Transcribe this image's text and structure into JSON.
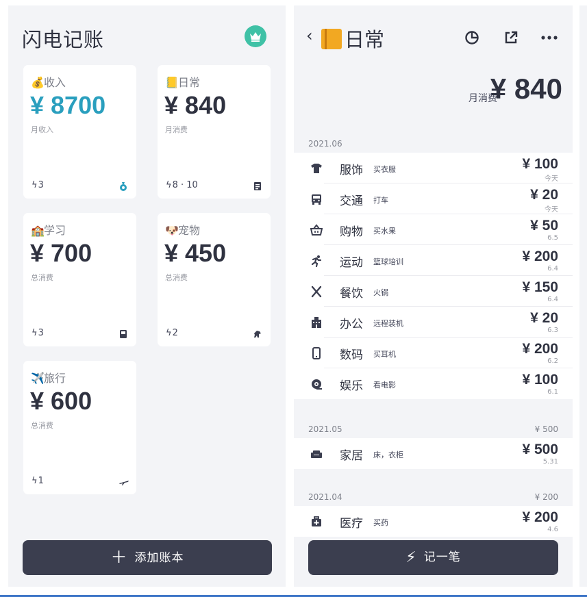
{
  "left": {
    "title": "闪电记账",
    "premium_icon": "crown-icon",
    "books": [
      {
        "emoji": "💰",
        "name": "收入",
        "amount": "¥ 8700",
        "subtitle": "月收入",
        "count": "3",
        "icon": "money-bag-icon",
        "accent": "#2a9fbe"
      },
      {
        "emoji": "📒",
        "name": "日常",
        "amount": "¥ 840",
        "subtitle": "月消费",
        "count": "8 · 10",
        "icon": "notes-icon"
      },
      {
        "emoji": "🏫",
        "name": "学习",
        "amount": "¥ 700",
        "subtitle": "总消费",
        "count": "3",
        "icon": "book-icon"
      },
      {
        "emoji": "🐶",
        "name": "宠物",
        "amount": "¥ 450",
        "subtitle": "总消费",
        "count": "2",
        "icon": "dog-icon"
      },
      {
        "emoji": "✈️",
        "name": "旅行",
        "amount": "¥ 600",
        "subtitle": "总消费",
        "count": "1",
        "icon": "plane-icon"
      }
    ],
    "add_button": {
      "icon": "＋",
      "label": "添加账本"
    }
  },
  "right": {
    "back_icon": "‹",
    "book_emoji": "📒",
    "title": "日常",
    "header_icons": [
      "pie-chart-icon",
      "share-icon",
      "more-icon"
    ],
    "month_label": "月消费",
    "month_amount": "¥ 840",
    "groups": [
      {
        "date": "2021.06",
        "total": "",
        "rows": [
          {
            "icon": "shirt-icon",
            "category": "服饰",
            "note": "买衣服",
            "amount": "¥ 100",
            "date": "今天"
          },
          {
            "icon": "bus-icon",
            "category": "交通",
            "note": "打车",
            "amount": "¥ 20",
            "date": "今天"
          },
          {
            "icon": "basket-icon",
            "category": "购物",
            "note": "买水果",
            "amount": "¥ 50",
            "date": "6.5"
          },
          {
            "icon": "running-icon",
            "category": "运动",
            "note": "篮球培训",
            "amount": "¥ 200",
            "date": "6.4"
          },
          {
            "icon": "utensils-icon",
            "category": "餐饮",
            "note": "火锅",
            "amount": "¥ 150",
            "date": "6.4"
          },
          {
            "icon": "office-icon",
            "category": "办公",
            "note": "远程装机",
            "amount": "¥ 20",
            "date": "6.3"
          },
          {
            "icon": "phone-icon",
            "category": "数码",
            "note": "买耳机",
            "amount": "¥ 200",
            "date": "6.2"
          },
          {
            "icon": "film-icon",
            "category": "娱乐",
            "note": "看电影",
            "amount": "¥ 100",
            "date": "6.1"
          }
        ]
      },
      {
        "date": "2021.05",
        "total": "¥ 500",
        "rows": [
          {
            "icon": "sofa-icon",
            "category": "家居",
            "note": "床，衣柜",
            "amount": "¥ 500",
            "date": "5.31"
          }
        ]
      },
      {
        "date": "2021.04",
        "total": "¥ 200",
        "rows": [
          {
            "icon": "medkit-icon",
            "category": "医疗",
            "note": "买药",
            "amount": "¥ 200",
            "date": "4.6"
          }
        ]
      }
    ],
    "record_button": {
      "icon": "⚡",
      "label": "记一笔"
    }
  }
}
